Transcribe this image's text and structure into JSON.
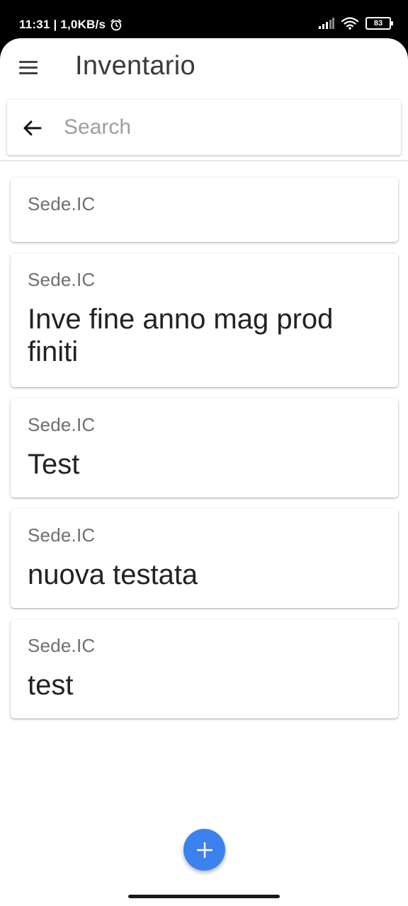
{
  "status_bar": {
    "time_speed": "11:31 | 1,0KB/s",
    "battery": "83",
    "icons": [
      "alarm-icon",
      "signal-icon",
      "wifi-icon",
      "battery-icon"
    ]
  },
  "app_bar": {
    "title": "Inventario",
    "menu_icon": "menu-icon"
  },
  "search": {
    "placeholder": "Search",
    "value": "",
    "back_icon": "arrow-back-icon"
  },
  "items": [
    {
      "subtitle": "Sede.IC",
      "title": ""
    },
    {
      "subtitle": "Sede.IC",
      "title": "Inve fine anno mag prod finiti"
    },
    {
      "subtitle": "Sede.IC",
      "title": "Test"
    },
    {
      "subtitle": "Sede.IC",
      "title": "nuova testata"
    },
    {
      "subtitle": "Sede.IC",
      "title": "test"
    }
  ],
  "fab": {
    "icon": "add-icon"
  },
  "colors": {
    "accent": "#3b82f0",
    "status_bar": "#000000",
    "background": "#ffffff"
  }
}
